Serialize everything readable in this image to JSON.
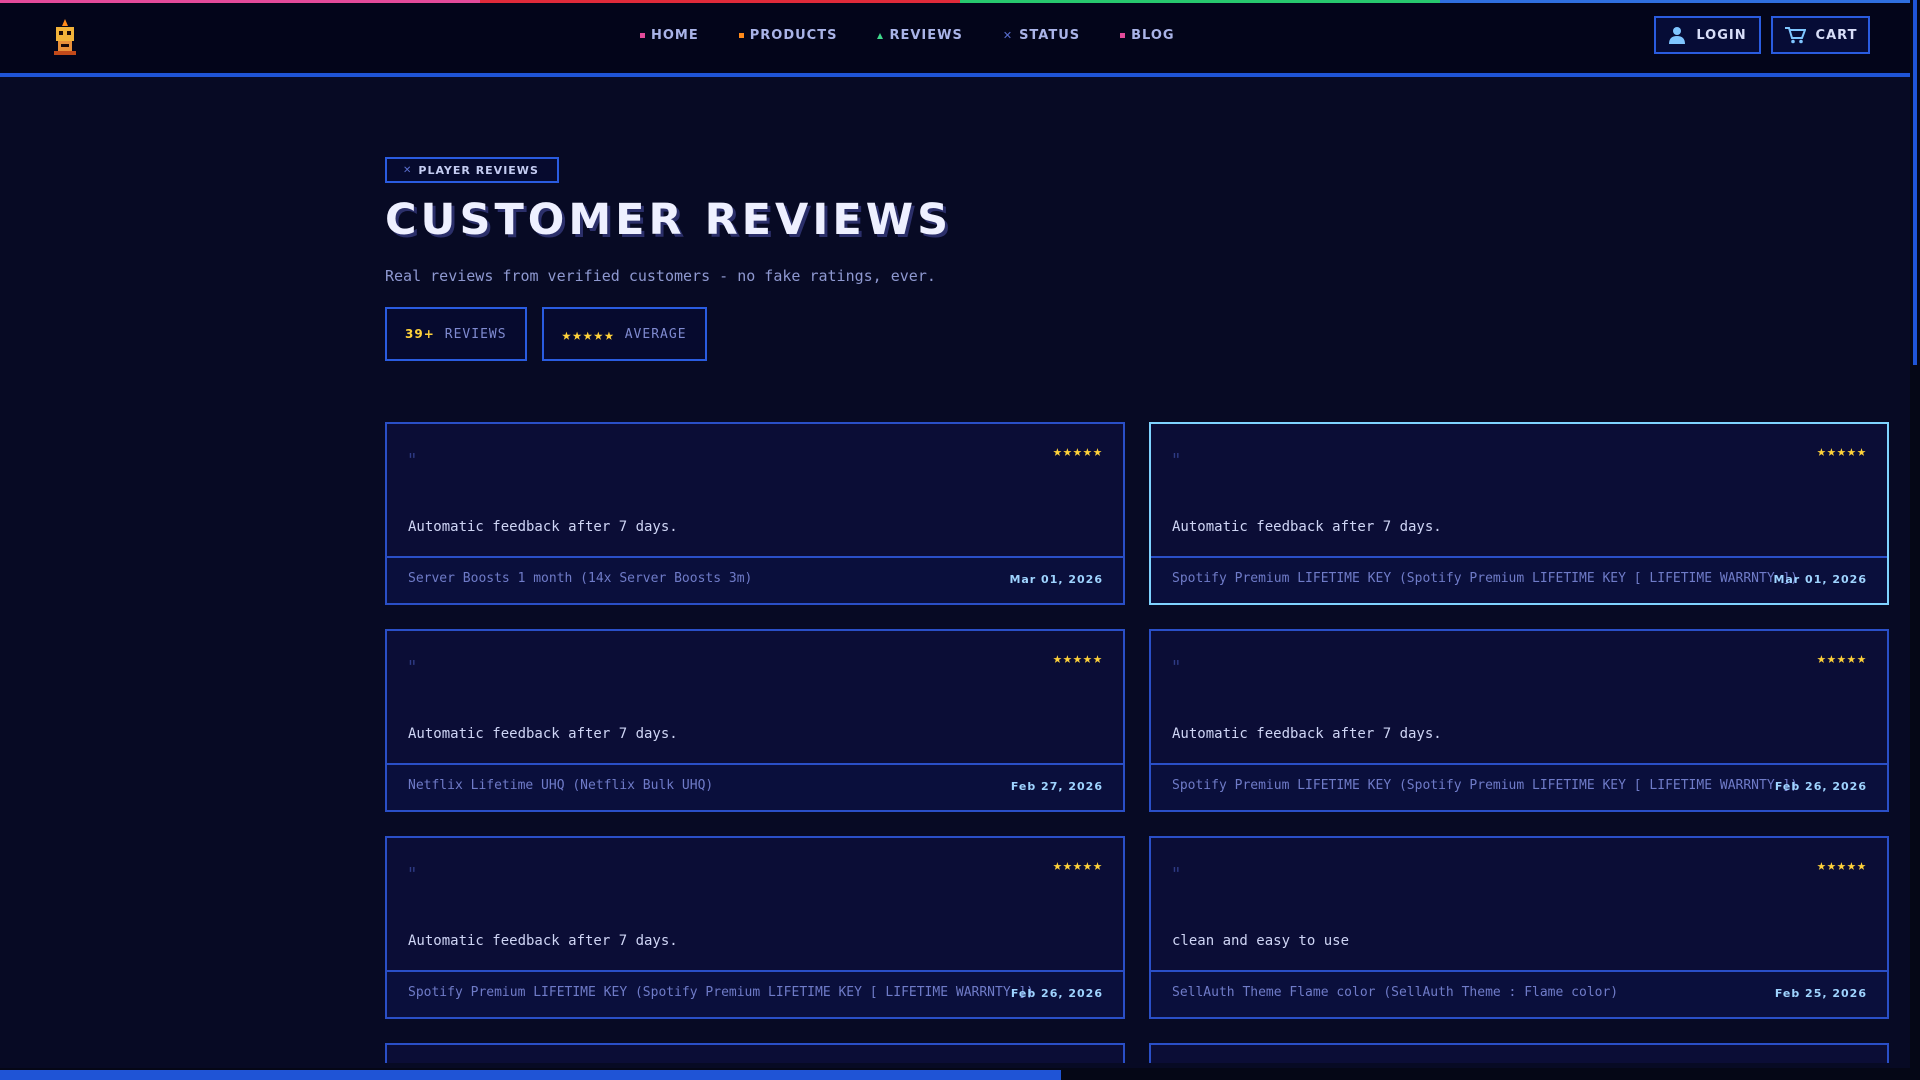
{
  "colors": {
    "accent": "#1f54d6",
    "star": "#ffd23a",
    "background": "#070a24",
    "stripe": [
      "#e24a9a",
      "#e02a3a",
      "#27c86e",
      "#2f6fe0"
    ]
  },
  "header": {
    "logo_icon": "robot-logo-icon",
    "nav": [
      {
        "label": "HOME",
        "icon": "pink-square-dot"
      },
      {
        "label": "PRODUCTS",
        "icon": "orange-square-dot"
      },
      {
        "label": "REVIEWS",
        "icon": "green-triangle"
      },
      {
        "label": "STATUS",
        "icon": "blue-x"
      },
      {
        "label": "BLOG",
        "icon": "pink-square-dot"
      }
    ],
    "login_label": "LOGIN",
    "cart_label": "CART"
  },
  "page": {
    "badge": "PLAYER REVIEWS",
    "title": "CUSTOMER REVIEWS",
    "subtitle": "Real reviews from verified customers - no fake ratings, ever.",
    "stats": {
      "count": "39+",
      "count_label": "REVIEWS",
      "stars": "★★★★★",
      "avg_label": "AVERAGE"
    }
  },
  "reviews": [
    {
      "stars": "★★★★★",
      "text": "Automatic feedback after 7 days.",
      "product": "Server Boosts 1 month (14x Server Boosts 3m)",
      "date": "Mar 01, 2026"
    },
    {
      "stars": "★★★★★",
      "text": "Automatic feedback after 7 days.",
      "product": "Spotify Premium LIFETIME KEY (Spotify Premium LIFETIME KEY [ LIFETIME WARRNTY ])",
      "date": "Mar 01, 2026"
    },
    {
      "stars": "★★★★★",
      "text": "Automatic feedback after 7 days.",
      "product": "Netflix Lifetime UHQ (Netflix Bulk UHQ)",
      "date": "Feb 27, 2026"
    },
    {
      "stars": "★★★★★",
      "text": "Automatic feedback after 7 days.",
      "product": "Spotify Premium LIFETIME KEY (Spotify Premium LIFETIME KEY [ LIFETIME WARRNTY ])",
      "date": "Feb 26, 2026"
    },
    {
      "stars": "★★★★★",
      "text": "Automatic feedback after 7 days.",
      "product": "Spotify Premium LIFETIME KEY (Spotify Premium LIFETIME KEY [ LIFETIME WARRNTY ])",
      "date": "Feb 26, 2026"
    },
    {
      "stars": "★★★★★",
      "text": "clean and easy to use",
      "product": "SellAuth Theme Flame color (SellAuth Theme : Flame color)",
      "date": "Feb 25, 2026"
    }
  ]
}
